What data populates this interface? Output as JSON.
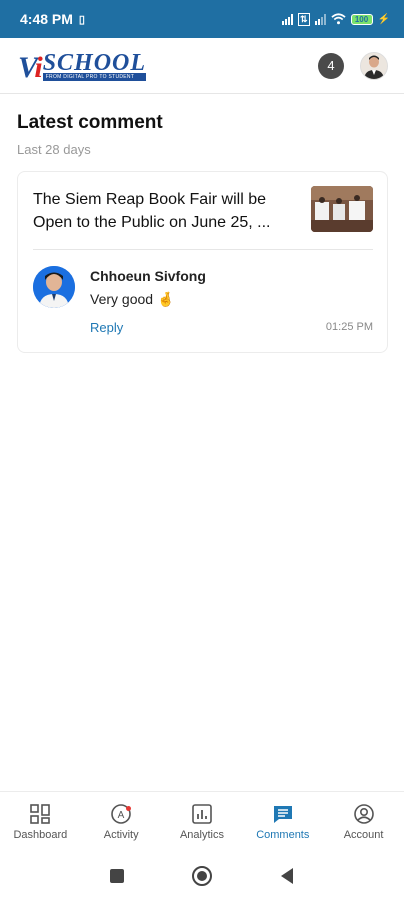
{
  "status": {
    "time": "4:48 PM",
    "battery": "100"
  },
  "header": {
    "notification_count": "4"
  },
  "logo": {
    "vi": "Vi",
    "school": "SCHOOL",
    "tagline": "FROM DIGITAL PRO TO STUDENT"
  },
  "section": {
    "title": "Latest comment",
    "subtitle": "Last 28 days"
  },
  "comment_card": {
    "post_title": "The Siem Reap Book Fair will be Open to the Public on June 25, ...",
    "commenter": "Chhoeun Sivfong",
    "text": "Very good 🤞",
    "reply_label": "Reply",
    "time": "01:25 PM"
  },
  "nav": [
    {
      "label": "Dashboard",
      "icon": "dashboard-icon"
    },
    {
      "label": "Activity",
      "icon": "activity-icon"
    },
    {
      "label": "Analytics",
      "icon": "analytics-icon"
    },
    {
      "label": "Comments",
      "icon": "comments-icon"
    },
    {
      "label": "Account",
      "icon": "account-icon"
    }
  ],
  "colors": {
    "primary": "#1f6fa3",
    "active": "#1f78b4"
  }
}
